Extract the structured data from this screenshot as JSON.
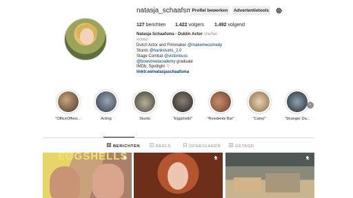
{
  "profile": {
    "username": "natasja_schaafsma",
    "edit_label": "Profiel bewerken",
    "ads_label": "Advertentietools",
    "stats": {
      "posts_count": "127",
      "posts_label": "berichten",
      "followers_count": "1.422",
      "followers_label": "volgers",
      "following_count": "1.492",
      "following_label": "volgend"
    },
    "bio": {
      "name": "Natasja Schaafsma - Dublin Actor",
      "pronouns": "she/her",
      "category": "Acteur",
      "line1_text": "Dutch Actor and Filmmaker",
      "line1_mention": "@makemecomedy",
      "line2_text": "Stunts",
      "line2_mention": "@hankstunts_2.0",
      "line3_text": "Stage Combat",
      "line3_mention": "@victoriousc",
      "line4_mention": "@bowstreetacademy",
      "line4_text": "graduate",
      "line5_text": "IMDb, Spotlight 👇🏻",
      "link": "linktr.ee/natasjaschaafsma"
    }
  },
  "highlights": [
    {
      "label": "\"OfficeOffenc..."
    },
    {
      "label": "Acting"
    },
    {
      "label": "Stunts"
    },
    {
      "label": "\"Eggshells\""
    },
    {
      "label": "\"Residents Bar\""
    },
    {
      "label": "\"Camp\""
    },
    {
      "label": "\"Stranger Da..."
    }
  ],
  "tabs": [
    {
      "label": "BERICHTEN"
    },
    {
      "label": "REELS"
    },
    {
      "label": "OPGESLAGEN"
    },
    {
      "label": "GETAGD"
    }
  ],
  "posts": {
    "post1_overlay_text": "EGGSHELLS"
  },
  "colors": {
    "link": "#00376b",
    "muted": "#8e8e8e",
    "button_bg": "#efefef"
  },
  "icons": [
    "gear-icon",
    "grid-icon",
    "reels-icon",
    "bookmark-icon",
    "tagged-icon",
    "pin-icon",
    "chevron-right-icon"
  ]
}
